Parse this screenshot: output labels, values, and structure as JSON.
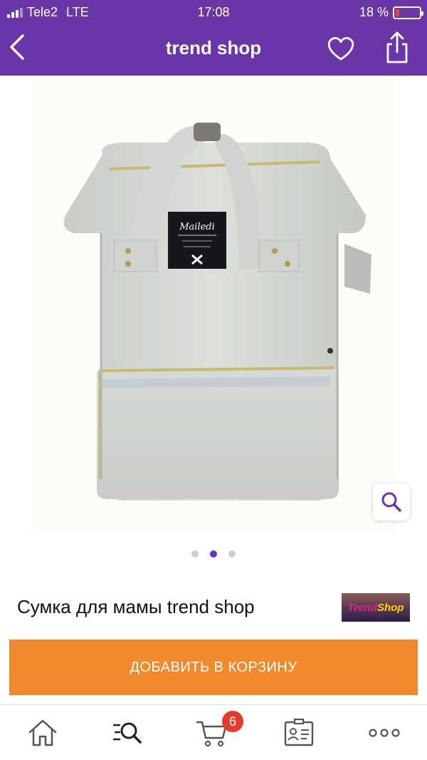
{
  "status_bar": {
    "carrier": "Tele2",
    "network": "LTE",
    "time": "17:08",
    "battery": "18 %",
    "battery_level": 0.18
  },
  "header": {
    "title": "trend shop",
    "back_icon": "chevron-left-icon",
    "favorite_icon": "heart-icon",
    "share_icon": "share-icon"
  },
  "gallery": {
    "image": "product-photo-backpack",
    "current_index": 2,
    "total": 3,
    "zoom_icon": "magnifier-icon"
  },
  "product": {
    "title": "Сумка для мамы trend shop",
    "logo": {
      "part1": "Trend",
      "part2": "Shop"
    }
  },
  "actions": {
    "add_to_cart": "ДОБАВИТЬ В КОРЗИНУ"
  },
  "tabbar": {
    "items": [
      {
        "icon": "home-icon"
      },
      {
        "icon": "catalog-search-icon"
      },
      {
        "icon": "cart-icon",
        "badge": "6"
      },
      {
        "icon": "profile-card-icon"
      },
      {
        "icon": "more-icon"
      }
    ]
  },
  "colors": {
    "header": "#6a35a6",
    "accent": "#6a2fc4",
    "button": "#f08a2d",
    "badge": "#e8392f"
  }
}
